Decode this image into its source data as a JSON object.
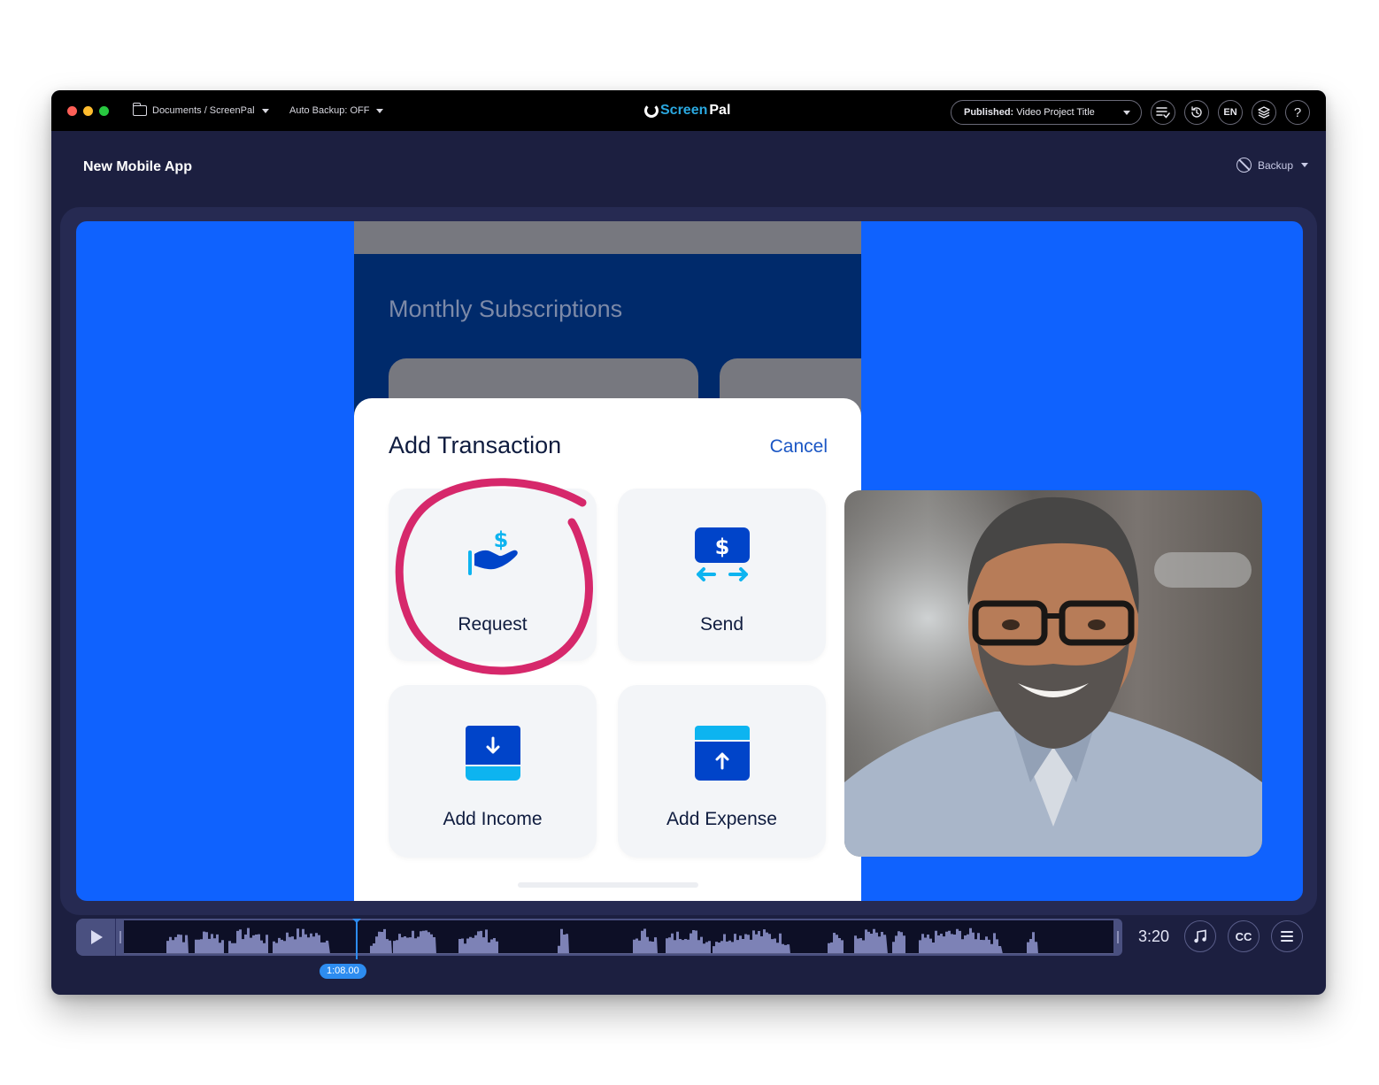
{
  "window": {
    "breadcrumb": "Documents / ScreenPal",
    "auto_backup": "Auto Backup: OFF",
    "logo": {
      "part1": "Screen",
      "part2": "Pal"
    },
    "publish": {
      "prefix": "Published:",
      "title": "Video Project Title"
    },
    "toolbar": {
      "checklist_icon": "checklist-icon",
      "history_icon": "history-icon",
      "language_label": "EN",
      "layers_icon": "layers-icon",
      "help_label": "?"
    }
  },
  "project": {
    "title": "New Mobile App",
    "backup_label": "Backup"
  },
  "phone": {
    "heading": "Monthly Subscriptions",
    "sheet": {
      "title": "Add Transaction",
      "cancel": "Cancel",
      "tiles": [
        {
          "label": "Request",
          "icon": "hand-dollar-icon"
        },
        {
          "label": "Send",
          "icon": "send-money-icon"
        },
        {
          "label": "Add Income",
          "icon": "income-download-icon"
        },
        {
          "label": "Add Expense",
          "icon": "expense-upload-icon"
        }
      ]
    }
  },
  "colors": {
    "canvas_blue": "#0f62fe",
    "phone_navy": "#002a6b",
    "annotation": "#d6286b",
    "icon_dark_blue": "#0044c9",
    "icon_light_blue": "#0db4f0",
    "playhead": "#2d8cf0"
  },
  "webcam": {
    "description": "Smiling man with glasses and grey beard"
  },
  "timeline": {
    "playhead_time": "1:08.00",
    "duration": "3:20",
    "playhead_fraction": 0.34,
    "buttons": {
      "music": "music-icon",
      "captions": "CC",
      "menu": "menu-icon"
    }
  }
}
